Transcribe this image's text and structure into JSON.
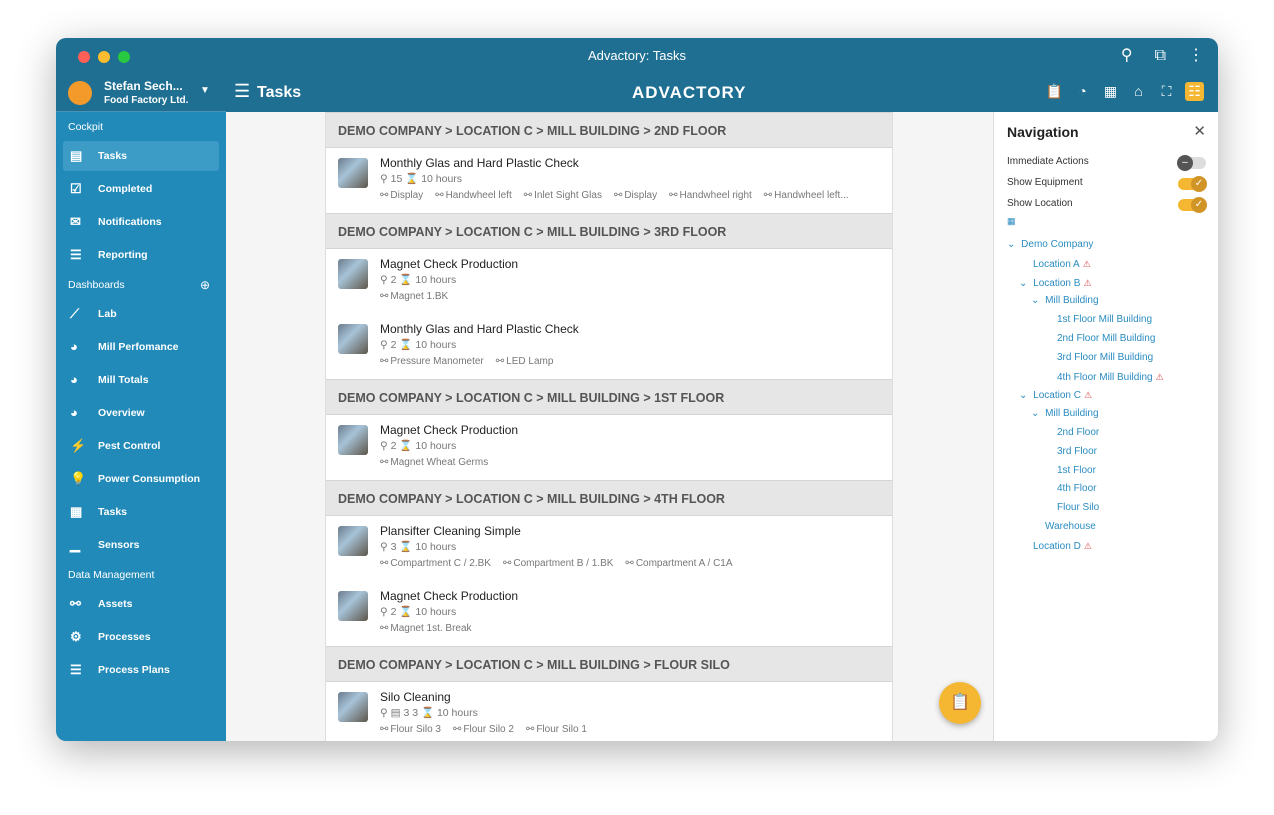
{
  "window": {
    "title": "Advactory: Tasks"
  },
  "header": {
    "user_name": "Stefan Sech...",
    "company": "Food Factory Ltd.",
    "page_title": "Tasks",
    "brand": "ADVACTORY"
  },
  "sidebar": {
    "sections": [
      {
        "label": "Cockpit",
        "items": [
          {
            "label": "Tasks",
            "icon": "clipboard-icon",
            "selected": true
          },
          {
            "label": "Completed",
            "icon": "check-clipboard-icon"
          },
          {
            "label": "Notifications",
            "icon": "mail-icon"
          },
          {
            "label": "Reporting",
            "icon": "list-icon"
          }
        ]
      },
      {
        "label": "Dashboards",
        "add": true,
        "items": [
          {
            "label": "Lab",
            "icon": "line-chart-icon"
          },
          {
            "label": "Mill Perfomance",
            "icon": "gauge-icon"
          },
          {
            "label": "Mill Totals",
            "icon": "gauge-icon"
          },
          {
            "label": "Overview",
            "icon": "gauge-icon"
          },
          {
            "label": "Pest Control",
            "icon": "pest-icon"
          },
          {
            "label": "Power Consumption",
            "icon": "bulb-icon"
          },
          {
            "label": "Tasks",
            "icon": "calendar-icon"
          },
          {
            "label": "Sensors",
            "icon": "sensor-chart-icon"
          }
        ]
      },
      {
        "label": "Data Management",
        "items": [
          {
            "label": "Assets",
            "icon": "hierarchy-icon"
          },
          {
            "label": "Processes",
            "icon": "process-icon"
          },
          {
            "label": "Process Plans",
            "icon": "checklist-icon"
          }
        ]
      }
    ]
  },
  "groups": [
    {
      "title": "DEMO COMPANY > LOCATION C > MILL BUILDING > 2ND FLOOR",
      "tasks": [
        {
          "name": "Monthly Glas and Hard Plastic Check",
          "meta": "15  ⌛ 10 hours",
          "equipment": [
            "Display",
            "Handwheel left",
            "Inlet Sight Glas",
            "Display",
            "Handwheel right",
            "Handwheel left..."
          ]
        }
      ]
    },
    {
      "title": "DEMO COMPANY > LOCATION C > MILL BUILDING > 3RD FLOOR",
      "tasks": [
        {
          "name": "Magnet Check Production",
          "meta": "2  ⌛ 10 hours",
          "equipment": [
            "Magnet 1.BK"
          ]
        },
        {
          "name": "Monthly Glas and Hard Plastic Check",
          "meta": "2  ⌛ 10 hours",
          "equipment": [
            "Pressure Manometer",
            "LED Lamp"
          ]
        }
      ]
    },
    {
      "title": "DEMO COMPANY > LOCATION C > MILL BUILDING > 1ST FLOOR",
      "tasks": [
        {
          "name": "Magnet Check Production",
          "meta": "2  ⌛ 10 hours",
          "equipment": [
            "Magnet Wheat Germs"
          ]
        }
      ]
    },
    {
      "title": "DEMO COMPANY > LOCATION C > MILL BUILDING > 4TH FLOOR",
      "tasks": [
        {
          "name": "Plansifter Cleaning Simple",
          "meta": "3  ⌛ 10 hours",
          "equipment": [
            "Compartment C / 2.BK",
            "Compartment B / 1.BK",
            "Compartment A / C1A"
          ]
        },
        {
          "name": "Magnet Check Production",
          "meta": "2  ⌛ 10 hours",
          "equipment": [
            "Magnet 1st. Break"
          ]
        }
      ]
    },
    {
      "title": "DEMO COMPANY > LOCATION C > MILL BUILDING > FLOUR SILO",
      "tasks": [
        {
          "name": "Silo Cleaning",
          "meta": "▤ 3  3  ⌛ 10 hours",
          "equipment": [
            "Flour Silo 3",
            "Flour Silo 2",
            "Flour Silo 1"
          ]
        }
      ]
    }
  ],
  "navigation": {
    "title": "Navigation",
    "toggles": [
      {
        "label": "Immediate Actions",
        "on": false
      },
      {
        "label": "Show Equipment",
        "on": true
      },
      {
        "label": "Show Location",
        "on": true
      }
    ],
    "tree": [
      {
        "label": "Demo Company",
        "level": 0,
        "expanded": true
      },
      {
        "label": "Location A",
        "level": 1,
        "alert": true
      },
      {
        "label": "Location B",
        "level": 1,
        "expanded": true,
        "alert": true
      },
      {
        "label": "Mill Building",
        "level": 2,
        "expanded": true
      },
      {
        "label": "1st Floor Mill Building",
        "level": 3
      },
      {
        "label": "2nd Floor Mill Building",
        "level": 3
      },
      {
        "label": "3rd Floor Mill Building",
        "level": 3
      },
      {
        "label": "4th Floor Mill Building",
        "level": 3,
        "alert": true
      },
      {
        "label": "Location C",
        "level": 1,
        "expanded": true,
        "alert": true
      },
      {
        "label": "Mill Building",
        "level": 2,
        "expanded": true
      },
      {
        "label": "2nd Floor",
        "level": 3
      },
      {
        "label": "3rd Floor",
        "level": 3
      },
      {
        "label": "1st Floor",
        "level": 3
      },
      {
        "label": "4th Floor",
        "level": 3
      },
      {
        "label": "Flour Silo",
        "level": 3
      },
      {
        "label": "Warehouse",
        "level": 2
      },
      {
        "label": "Location D",
        "level": 1,
        "alert": true
      }
    ]
  },
  "colors": {
    "header": "#1f6f93",
    "sidebar": "#218ab8",
    "accent": "#f5b731",
    "tree": "#2a8cc0",
    "alert": "#e04b4b"
  }
}
